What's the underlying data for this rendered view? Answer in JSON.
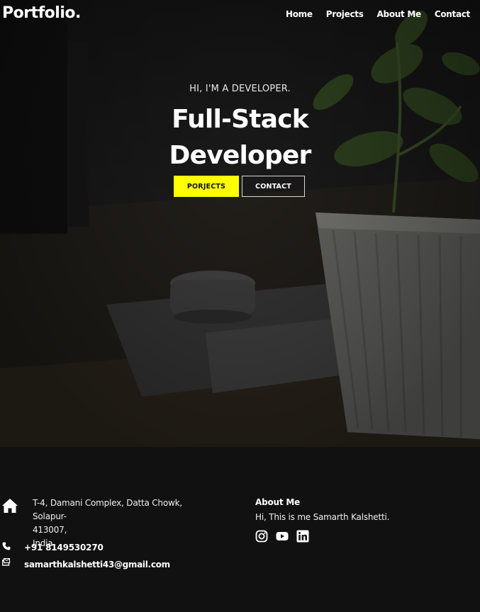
{
  "nav": {
    "logo": "Portfolio.",
    "links": [
      "Home",
      "Projects",
      "About Me",
      "Contact"
    ]
  },
  "hero": {
    "kicker": "HI, I'M A DEVELOPER.",
    "title_line1": "Full-Stack",
    "title_line2": "Developer",
    "primary_button": "PORJECTS",
    "secondary_button": "CONTACT"
  },
  "footer": {
    "address_line1": "T-4, Damani Complex, Datta Chowk, Solapur-",
    "address_line2": "413007,",
    "address_line3": "India.",
    "phone": "+91 8149530270",
    "email": "samarthkalshetti43@gmail.com",
    "about_heading": "About Me",
    "about_text": "Hi, This is me Samarth Kalshetti.",
    "social_icons": [
      "instagram-icon",
      "youtube-icon",
      "linkedin-icon"
    ]
  },
  "colors": {
    "accent": "#ffff00",
    "footer_bg": "#111111",
    "text": "#ffffff"
  }
}
